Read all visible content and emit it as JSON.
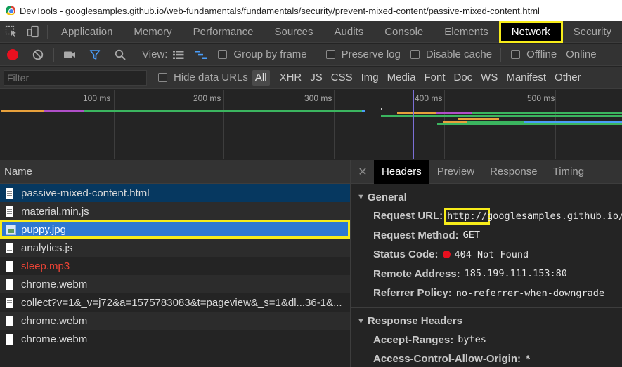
{
  "window": {
    "title": "DevTools - googlesamples.github.io/web-fundamentals/fundamentals/security/prevent-mixed-content/passive-mixed-content.html"
  },
  "tabs": [
    {
      "label": "Application"
    },
    {
      "label": "Memory"
    },
    {
      "label": "Performance"
    },
    {
      "label": "Sources"
    },
    {
      "label": "Audits"
    },
    {
      "label": "Console"
    },
    {
      "label": "Elements"
    },
    {
      "label": "Network",
      "active": true
    },
    {
      "label": "Security"
    }
  ],
  "toolbar": {
    "view_label": "View:",
    "group_by_frame": "Group by frame",
    "preserve_log": "Preserve log",
    "disable_cache": "Disable cache",
    "offline": "Offline",
    "online": "Online"
  },
  "filter": {
    "placeholder": "Filter",
    "hide_data_urls": "Hide data URLs",
    "types": [
      "All",
      "XHR",
      "JS",
      "CSS",
      "Img",
      "Media",
      "Font",
      "Doc",
      "WS",
      "Manifest",
      "Other"
    ]
  },
  "overview": {
    "ticks": [
      "100 ms",
      "200 ms",
      "300 ms",
      "400 ms",
      "500 ms"
    ]
  },
  "requests": {
    "header": "Name",
    "rows": [
      {
        "name": "passive-mixed-content.html",
        "icon": "document-icon",
        "state": "first"
      },
      {
        "name": "material.min.js",
        "icon": "script-icon",
        "state": "normal"
      },
      {
        "name": "puppy.jpg",
        "icon": "image-icon",
        "state": "selected"
      },
      {
        "name": "analytics.js",
        "icon": "script-icon",
        "state": "normal"
      },
      {
        "name": "sleep.mp3",
        "icon": "media-icon",
        "state": "failed"
      },
      {
        "name": "chrome.webm",
        "icon": "media-icon",
        "state": "normal"
      },
      {
        "name": "collect?v=1&_v=j72&a=1575783083&t=pageview&_s=1&dl...36-1&...",
        "icon": "document-icon",
        "state": "normal"
      },
      {
        "name": "chrome.webm",
        "icon": "media-icon",
        "state": "normal"
      },
      {
        "name": "chrome.webm",
        "icon": "media-icon",
        "state": "normal"
      }
    ]
  },
  "details": {
    "tabs": [
      "Headers",
      "Preview",
      "Response",
      "Timing"
    ],
    "general": {
      "title": "General",
      "request_url_label": "Request URL:",
      "request_url_scheme": "http://",
      "request_url_rest": "googlesamples.github.io/",
      "request_method_label": "Request Method:",
      "request_method": "GET",
      "status_code_label": "Status Code:",
      "status_code": "404 Not Found",
      "remote_address_label": "Remote Address:",
      "remote_address": "185.199.111.153:80",
      "referrer_policy_label": "Referrer Policy:",
      "referrer_policy": "no-referrer-when-downgrade"
    },
    "response_headers": {
      "title": "Response Headers",
      "accept_ranges_label": "Accept-Ranges:",
      "accept_ranges": "bytes",
      "acao_label": "Access-Control-Allow-Origin:",
      "acao": "*"
    }
  },
  "colors": {
    "highlight": "#f7ec1a",
    "selected_row": "#2e78d1",
    "error_red": "#ea4335",
    "record_red": "#e8101f"
  }
}
